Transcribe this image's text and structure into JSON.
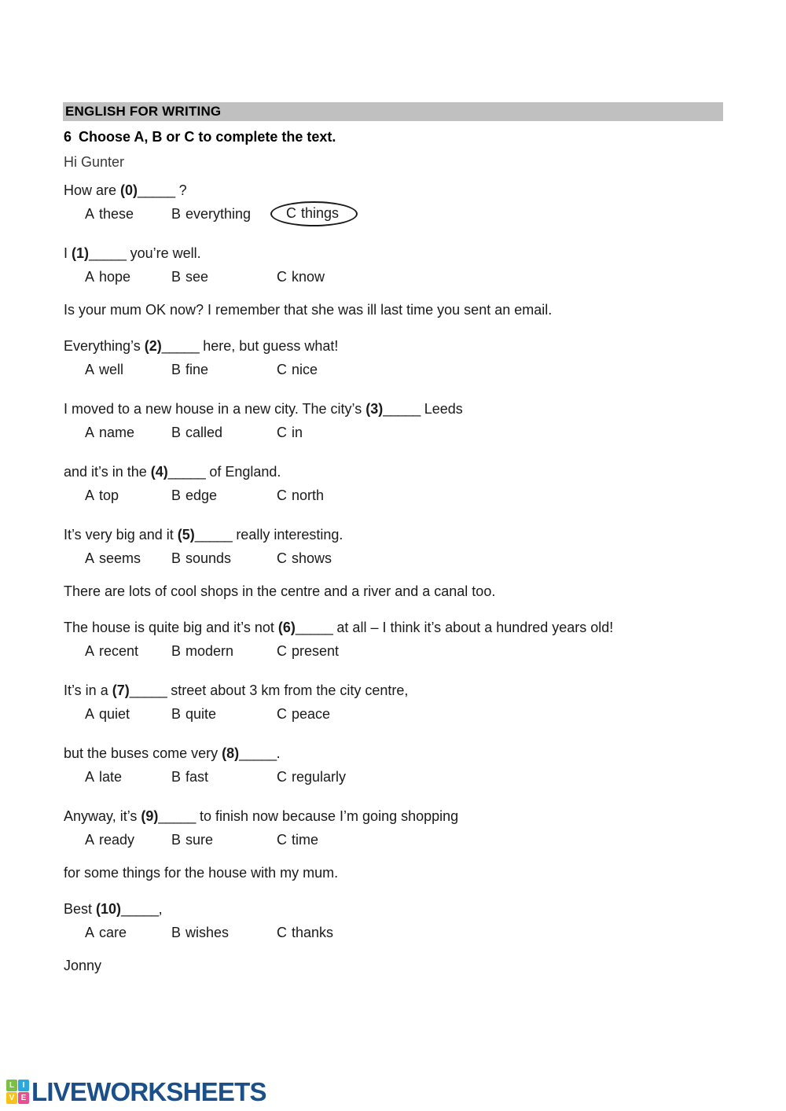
{
  "section": {
    "title": "ENGLISH FOR WRITING",
    "bar_color": "#c0c0c0"
  },
  "exercise": {
    "number": "6",
    "instruction": "Choose A, B or C to complete the text."
  },
  "letter": {
    "salutation": "Hi Gunter",
    "signature": "Jonny"
  },
  "items": [
    {
      "prompt_before": "How are ",
      "marker": "(0)",
      "blank": "_____",
      "prompt_after": " ?",
      "options": [
        {
          "letter": "A",
          "text": "these"
        },
        {
          "letter": "B",
          "text": "everything"
        },
        {
          "letter": "C",
          "text": "things"
        }
      ],
      "circled_option": "C"
    },
    {
      "prompt_before": "I ",
      "marker": "(1)",
      "blank": "_____",
      "prompt_after": " you’re well.",
      "options": [
        {
          "letter": "A",
          "text": "hope"
        },
        {
          "letter": "B",
          "text": "see"
        },
        {
          "letter": "C",
          "text": "know"
        }
      ],
      "circled_option": ""
    },
    {
      "prompt_before": "Everything’s ",
      "marker": "(2)",
      "blank": "_____",
      "prompt_after": " here, but guess what!",
      "options": [
        {
          "letter": "A",
          "text": "well"
        },
        {
          "letter": "B",
          "text": "fine"
        },
        {
          "letter": "C",
          "text": "nice"
        }
      ],
      "circled_option": ""
    },
    {
      "prompt_before": "I moved to a new house in a new city. The city’s ",
      "marker": "(3)",
      "blank": "_____",
      "prompt_after": " Leeds",
      "options": [
        {
          "letter": "A",
          "text": "name"
        },
        {
          "letter": "B",
          "text": "called"
        },
        {
          "letter": "C",
          "text": "in"
        }
      ],
      "circled_option": ""
    },
    {
      "prompt_before": "and it’s in the ",
      "marker": "(4)",
      "blank": "_____",
      "prompt_after": " of England.",
      "options": [
        {
          "letter": "A",
          "text": "top"
        },
        {
          "letter": "B",
          "text": "edge"
        },
        {
          "letter": "C",
          "text": "north"
        }
      ],
      "circled_option": ""
    },
    {
      "prompt_before": "It’s very big and it ",
      "marker": "(5)",
      "blank": "_____",
      "prompt_after": " really interesting.",
      "options": [
        {
          "letter": "A",
          "text": "seems"
        },
        {
          "letter": "B",
          "text": "sounds"
        },
        {
          "letter": "C",
          "text": "shows"
        }
      ],
      "circled_option": ""
    },
    {
      "prompt_before": "The house is quite big and it’s not ",
      "marker": "(6)",
      "blank": "_____",
      "prompt_after": " at all – I think it’s about a hundred years old!",
      "options": [
        {
          "letter": "A",
          "text": "recent"
        },
        {
          "letter": "B",
          "text": "modern"
        },
        {
          "letter": "C",
          "text": "present"
        }
      ],
      "circled_option": ""
    },
    {
      "prompt_before": "It’s in a ",
      "marker": "(7)",
      "blank": "_____",
      "prompt_after": " street about 3 km from the city centre,",
      "options": [
        {
          "letter": "A",
          "text": "quiet"
        },
        {
          "letter": "B",
          "text": "quite"
        },
        {
          "letter": "C",
          "text": "peace"
        }
      ],
      "circled_option": ""
    },
    {
      "prompt_before": "but the buses come very ",
      "marker": "(8)",
      "blank": "_____",
      "prompt_after": ".",
      "options": [
        {
          "letter": "A",
          "text": "late"
        },
        {
          "letter": "B",
          "text": "fast"
        },
        {
          "letter": "C",
          "text": "regularly"
        }
      ],
      "circled_option": ""
    },
    {
      "prompt_before": "Anyway, it’s ",
      "marker": "(9)",
      "blank": "_____",
      "prompt_after": " to finish now because I’m going shopping",
      "options": [
        {
          "letter": "A",
          "text": "ready"
        },
        {
          "letter": "B",
          "text": "sure"
        },
        {
          "letter": "C",
          "text": "time"
        }
      ],
      "circled_option": ""
    },
    {
      "prompt_before": "Best ",
      "marker": "(10)",
      "blank": "_____",
      "prompt_after": ",",
      "options": [
        {
          "letter": "A",
          "text": "care"
        },
        {
          "letter": "B",
          "text": "wishes"
        },
        {
          "letter": "C",
          "text": "thanks"
        }
      ],
      "circled_option": ""
    }
  ],
  "narrations": {
    "n1": "Is your mum OK now? I remember that she was ill last time you sent an email.",
    "n2": "There are lots of cool shops in the centre and a river and a canal too.",
    "n3": "for some things for the house with my mum."
  },
  "footer": {
    "tiles": [
      {
        "letter": "L",
        "color": "#7ac143"
      },
      {
        "letter": "I",
        "color": "#2aa9e0"
      },
      {
        "letter": "V",
        "color": "#f6c316"
      },
      {
        "letter": "E",
        "color": "#ec4d8f"
      }
    ],
    "wordmark": "LIVEWORKSHEETS",
    "wordmark_color": "#1b4f8a"
  }
}
